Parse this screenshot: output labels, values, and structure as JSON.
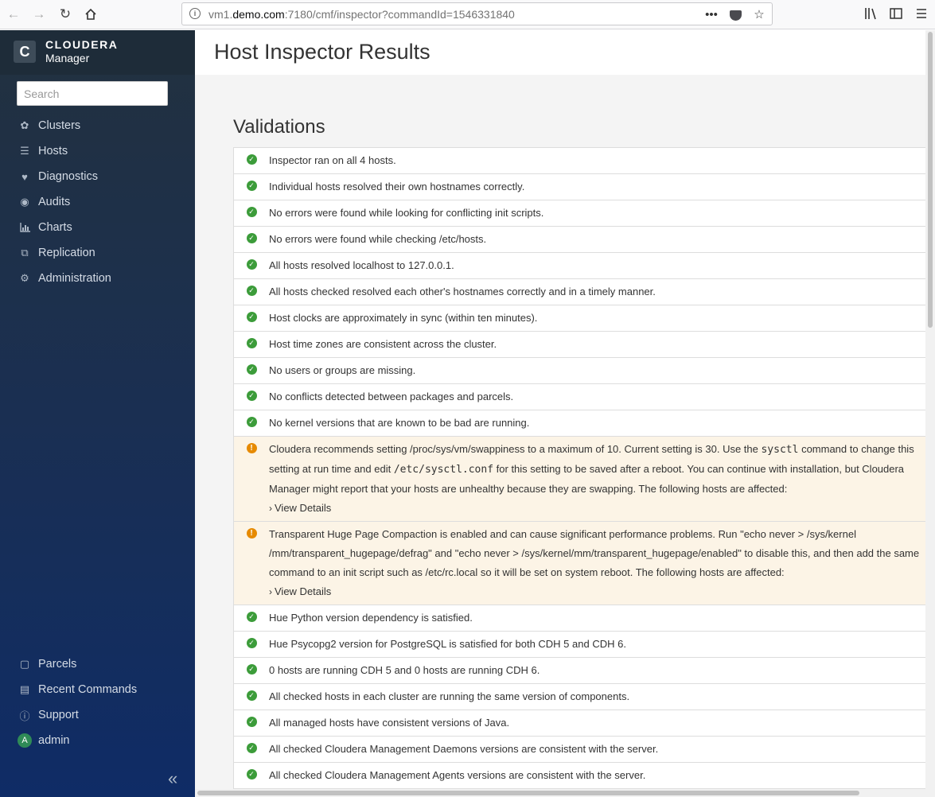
{
  "browser": {
    "url_prefix": "vm1.",
    "url_domain": "demo.com",
    "url_suffix": ":7180/cmf/inspector?commandId=1546331840"
  },
  "sidebar": {
    "brand": "CLOUDERA",
    "product": "Manager",
    "search_placeholder": "Search",
    "nav": [
      {
        "label": "Clusters",
        "icon": "clusters-icon"
      },
      {
        "label": "Hosts",
        "icon": "hosts-icon"
      },
      {
        "label": "Diagnostics",
        "icon": "heartbeat-icon"
      },
      {
        "label": "Audits",
        "icon": "binoculars-icon"
      },
      {
        "label": "Charts",
        "icon": "bar-chart-icon"
      },
      {
        "label": "Replication",
        "icon": "replication-icon"
      },
      {
        "label": "Administration",
        "icon": "gear-icon"
      }
    ],
    "bottom": [
      {
        "label": "Parcels",
        "icon": "parcel-icon"
      },
      {
        "label": "Recent Commands",
        "icon": "commands-icon"
      },
      {
        "label": "Support",
        "icon": "question-icon"
      },
      {
        "label": "admin",
        "icon": "avatar"
      }
    ],
    "avatar_letter": "A"
  },
  "page": {
    "title": "Host Inspector Results",
    "section_title": "Validations"
  },
  "validations": [
    "Inspector ran on all 4 hosts.",
    "Individual hosts resolved their own hostnames correctly.",
    "No errors were found while looking for conflicting init scripts.",
    "No errors were found while checking /etc/hosts.",
    "All hosts resolved localhost to 127.0.0.1.",
    "All hosts checked resolved each other's hostnames correctly and in a timely manner.",
    "Host clocks are approximately in sync (within ten minutes).",
    "Host time zones are consistent across the cluster.",
    "No users or groups are missing.",
    "No conflicts detected between packages and parcels.",
    "No kernel versions that are known to be bad are running."
  ],
  "warning1": {
    "part1": "Cloudera recommends setting /proc/sys/vm/swappiness to a maximum of 10. Current setting is 30. Use the ",
    "code1": "sysctl",
    "part2": " command to change this setting at run time and edit ",
    "code2": "/etc/sysctl.conf",
    "part3": " for this setting to be saved after a reboot. You can continue with installation, but Cloudera Manager might report that your hosts are unhealthy because they are swapping. The following hosts are affected:",
    "details": "View Details"
  },
  "warning2": {
    "text": "Transparent Huge Page Compaction is enabled and can cause significant performance problems. Run \"echo never > /sys/kernel /mm/transparent_hugepage/defrag\" and \"echo never > /sys/kernel/mm/transparent_hugepage/enabled\" to disable this, and then add the same command to an init script such as /etc/rc.local so it will be set on system reboot. The following hosts are affected:",
    "details": "View Details"
  },
  "validations_after": [
    "Hue Python version dependency is satisfied.",
    "Hue Psycopg2 version for PostgreSQL is satisfied for both CDH 5 and CDH 6.",
    "0 hosts are running CDH 5 and 0 hosts are running CDH 6.",
    "All checked hosts in each cluster are running the same version of components.",
    "All managed hosts have consistent versions of Java.",
    "All checked Cloudera Management Daemons versions are consistent with the server.",
    "All checked Cloudera Management Agents versions are consistent with the server."
  ],
  "colors": {
    "success": "#3c9c3a",
    "warning": "#e68a00",
    "warning_bg": "#fcf4e6",
    "sidebar_top": "#22313f",
    "sidebar_bottom": "#0f2c66"
  }
}
